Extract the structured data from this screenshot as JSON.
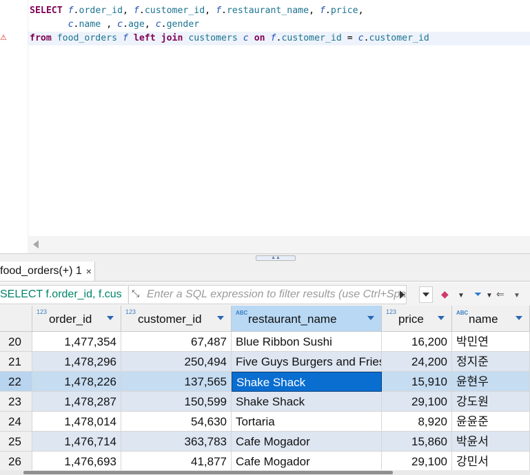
{
  "editor": {
    "line1": [
      "SELECT",
      " ",
      "f",
      ".",
      "order_id",
      ", ",
      "f",
      ".",
      "customer_id",
      ", ",
      "f",
      ".",
      "restaurant_name",
      ", ",
      "f",
      ".",
      "price",
      ","
    ],
    "line2": [
      "       ",
      "c",
      ".",
      "name",
      " , ",
      "c",
      ".",
      "age",
      ", ",
      "c",
      ".",
      "gender"
    ],
    "line3": [
      "from",
      " ",
      "food_orders",
      " ",
      "f",
      " ",
      "left",
      " ",
      "join",
      " ",
      "customers",
      " ",
      "c",
      " ",
      "on",
      " ",
      "f",
      ".",
      "customer_id",
      " = ",
      "c",
      ".",
      "customer_id"
    ],
    "warning_icon": "warning-triangle-icon"
  },
  "results_tab": {
    "label": "food_orders(+) 1",
    "close": "×"
  },
  "filter": {
    "sql_preview": "SELECT f.order_id, f.cus",
    "placeholder": "Enter a SQL expression to filter results (use Ctrl+Space)"
  },
  "grid": {
    "columns": [
      {
        "type": "123",
        "name": "order_id"
      },
      {
        "type": "123",
        "name": "customer_id"
      },
      {
        "type": "ABC",
        "name": "restaurant_name"
      },
      {
        "type": "123",
        "name": "price"
      },
      {
        "type": "ABC",
        "name": "name"
      }
    ],
    "rows": [
      {
        "n": "20",
        "order_id": "1,477,354",
        "customer_id": "67,487",
        "restaurant_name": "Blue Ribbon Sushi",
        "price": "16,200",
        "name": "박민연"
      },
      {
        "n": "21",
        "order_id": "1,478,296",
        "customer_id": "250,494",
        "restaurant_name": "Five Guys Burgers and Fries",
        "price": "24,200",
        "name": "정지준"
      },
      {
        "n": "22",
        "order_id": "1,478,226",
        "customer_id": "137,565",
        "restaurant_name": "Shake Shack",
        "price": "15,910",
        "name": "윤현우"
      },
      {
        "n": "23",
        "order_id": "1,478,287",
        "customer_id": "150,599",
        "restaurant_name": "Shake Shack",
        "price": "29,100",
        "name": "강도원"
      },
      {
        "n": "24",
        "order_id": "1,478,014",
        "customer_id": "54,630",
        "restaurant_name": "Tortaria",
        "price": "8,920",
        "name": "윤윤준"
      },
      {
        "n": "25",
        "order_id": "1,476,714",
        "customer_id": "363,783",
        "restaurant_name": "Cafe Mogador",
        "price": "15,860",
        "name": "박윤서"
      },
      {
        "n": "26",
        "order_id": "1,476,693",
        "customer_id": "41,877",
        "restaurant_name": "Cafe Mogador",
        "price": "29,100",
        "name": "강민서"
      }
    ]
  },
  "colors": {
    "accent": "#0a6ed1",
    "selected_header": "#b8d8f4",
    "alt_row": "#dde6f1"
  }
}
